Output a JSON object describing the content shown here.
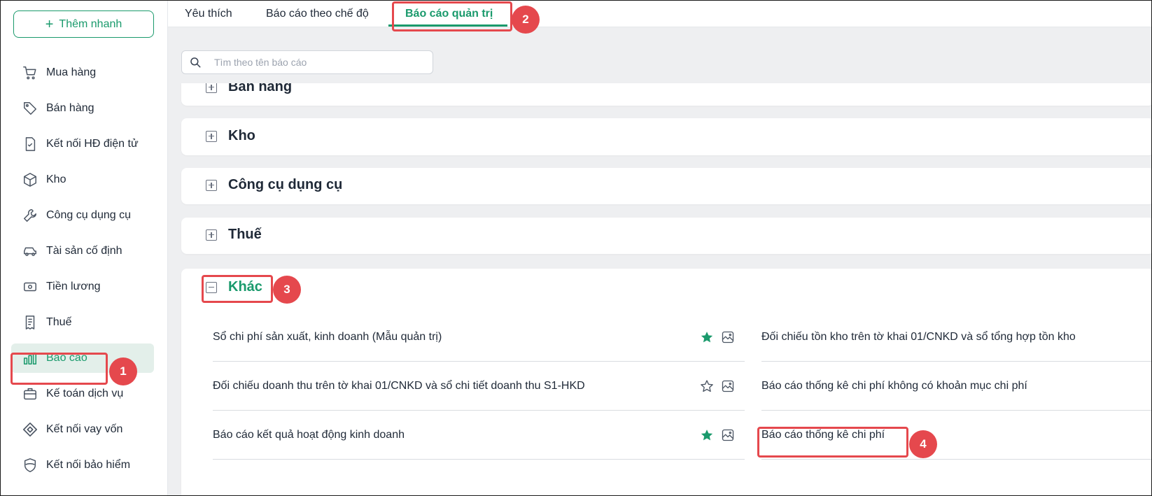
{
  "sidebar": {
    "quick_add": "Thêm nhanh",
    "items": [
      {
        "label": "Mua hàng",
        "icon": "cart-icon"
      },
      {
        "label": "Bán hàng",
        "icon": "tag-icon"
      },
      {
        "label": "Kết nối HĐ điện tử",
        "icon": "invoice-icon"
      },
      {
        "label": "Kho",
        "icon": "box-icon"
      },
      {
        "label": "Công cụ dụng cụ",
        "icon": "wrench-icon"
      },
      {
        "label": "Tài sản cố định",
        "icon": "car-icon"
      },
      {
        "label": "Tiền lương",
        "icon": "money-icon"
      },
      {
        "label": "Thuế",
        "icon": "receipt-icon"
      },
      {
        "label": "Báo cáo",
        "icon": "bar-chart-icon",
        "active": true
      },
      {
        "label": "Kế toán dịch vụ",
        "icon": "briefcase-icon"
      },
      {
        "label": "Kết nối vay vốn",
        "icon": "link-icon"
      },
      {
        "label": "Kết nối bảo hiểm",
        "icon": "shield-icon"
      }
    ]
  },
  "tabs": [
    {
      "label": "Yêu thích"
    },
    {
      "label": "Báo cáo theo chế độ"
    },
    {
      "label": "Báo cáo quản trị",
      "active": true
    }
  ],
  "search": {
    "placeholder": "Tìm theo tên báo cáo"
  },
  "groups": [
    {
      "label": "Bán hàng",
      "expanded": false
    },
    {
      "label": "Kho",
      "expanded": false
    },
    {
      "label": "Công cụ dụng cụ",
      "expanded": false
    },
    {
      "label": "Thuế",
      "expanded": false
    },
    {
      "label": "Khác",
      "expanded": true
    }
  ],
  "reports_left": [
    {
      "name": "Sổ chi phí sản xuất, kinh doanh (Mẫu quản trị)",
      "favorite": true
    },
    {
      "name": "Đối chiếu doanh thu trên tờ khai 01/CNKD và sổ chi tiết doanh thu S1-HKD",
      "favorite": false
    },
    {
      "name": "Báo cáo kết quả hoạt động kinh doanh",
      "favorite": true
    }
  ],
  "reports_right": [
    {
      "name": "Đối chiếu tồn kho trên tờ khai 01/CNKD và sổ tổng hợp tồn kho"
    },
    {
      "name": "Báo cáo thống kê chi phí không có khoản mục chi phí"
    },
    {
      "name": "Báo cáo thống kê chi phí"
    }
  ],
  "annotations": [
    "1",
    "2",
    "3",
    "4"
  ],
  "colors": {
    "accent": "#1a9a6c",
    "highlight": "#e5484d",
    "background": "#eeeff1"
  }
}
